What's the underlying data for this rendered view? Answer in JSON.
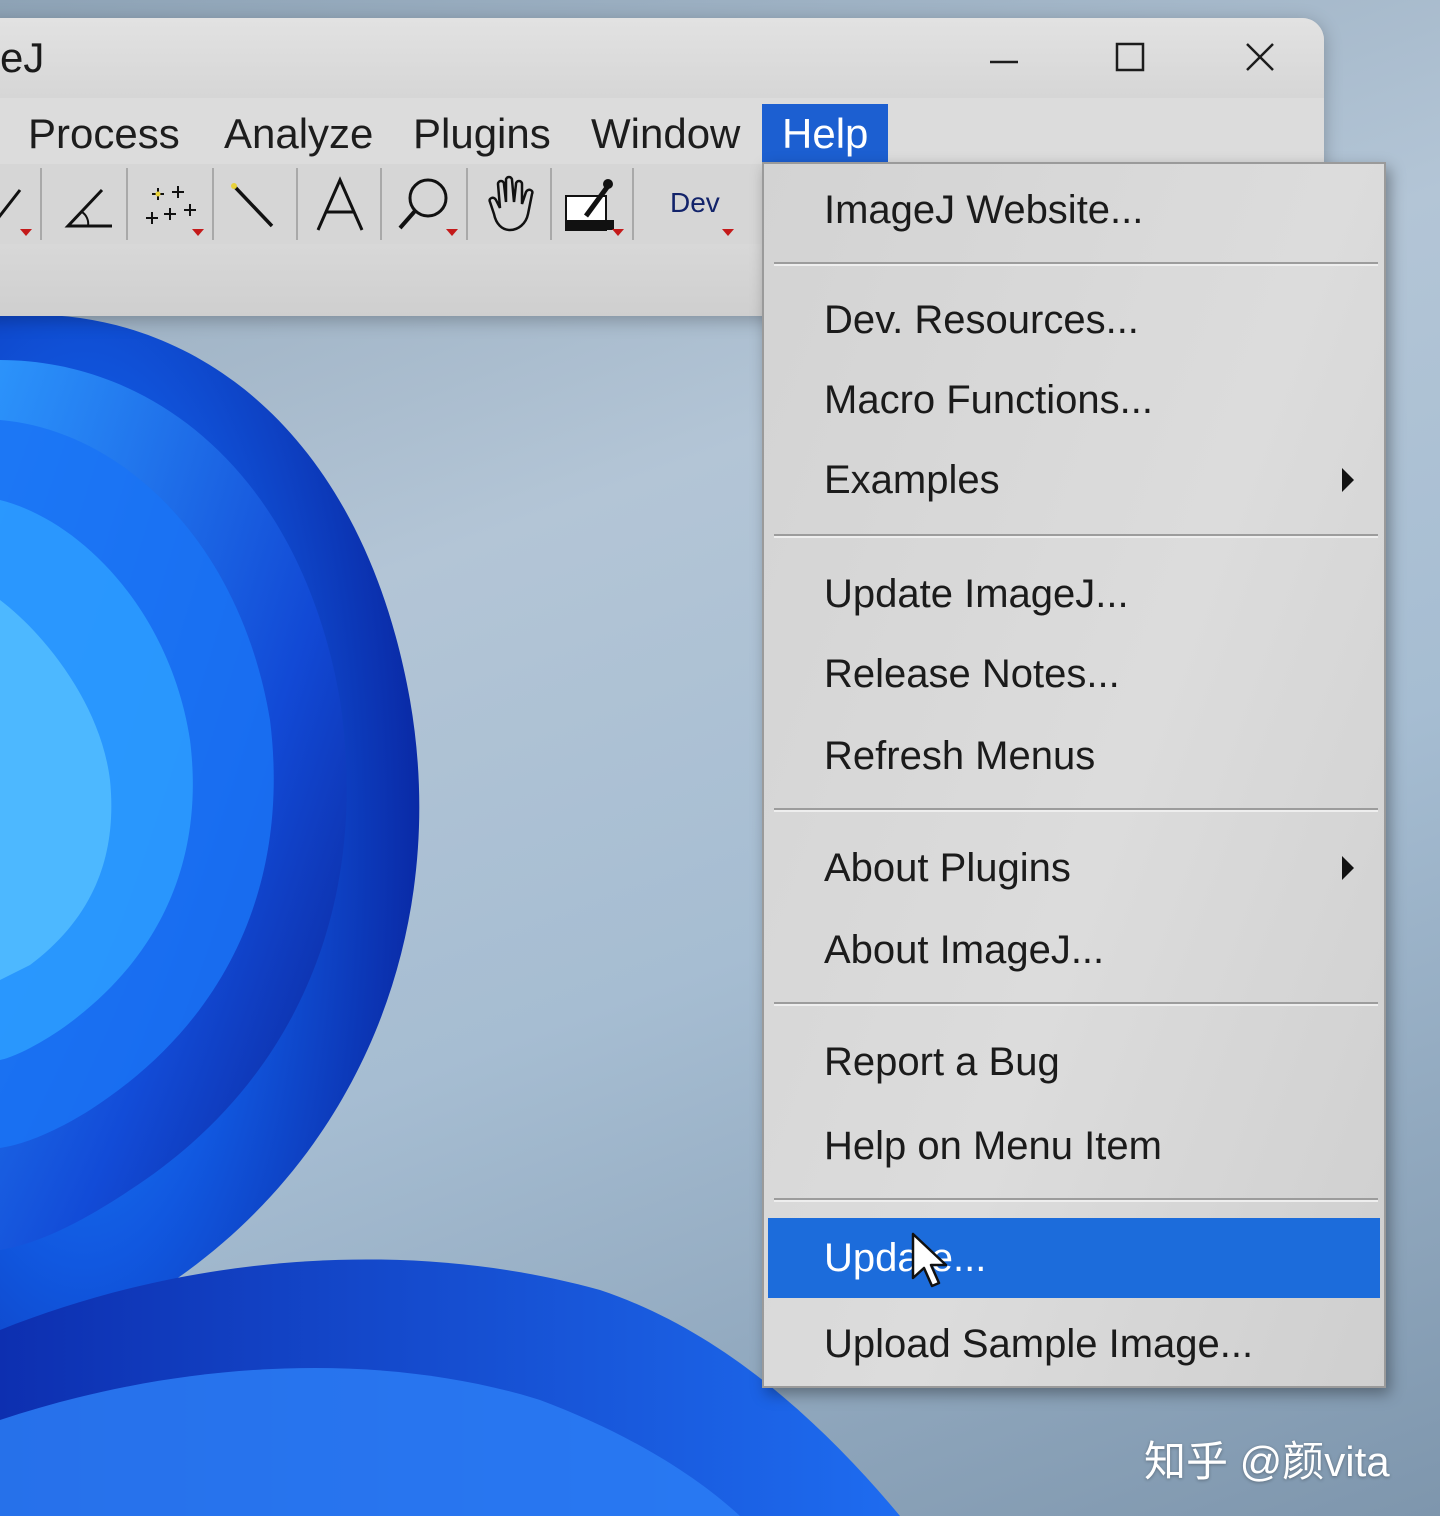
{
  "window": {
    "title": "eJ"
  },
  "menubar": {
    "items": [
      {
        "label": "Process"
      },
      {
        "label": "Analyze"
      },
      {
        "label": "Plugins"
      },
      {
        "label": "Window"
      },
      {
        "label": "Help",
        "active": true
      }
    ]
  },
  "toolbar": {
    "tools": [
      {
        "icon": "line-tool-icon"
      },
      {
        "icon": "angle-tool-icon"
      },
      {
        "icon": "point-tool-icon"
      },
      {
        "icon": "wand-tool-icon"
      },
      {
        "icon": "text-tool-icon"
      },
      {
        "icon": "magnifier-tool-icon"
      },
      {
        "icon": "hand-tool-icon"
      },
      {
        "icon": "color-picker-tool-icon"
      },
      {
        "icon": "dev-tool-icon",
        "label": "Dev"
      }
    ]
  },
  "help_menu": {
    "items": [
      {
        "label": "ImageJ Website..."
      },
      {
        "label": "Dev. Resources..."
      },
      {
        "label": "Macro Functions..."
      },
      {
        "label": "Examples",
        "submenu": true
      },
      {
        "label": "Update ImageJ..."
      },
      {
        "label": "Release Notes..."
      },
      {
        "label": "Refresh Menus"
      },
      {
        "label": "About Plugins",
        "submenu": true
      },
      {
        "label": "About ImageJ..."
      },
      {
        "label": "Report a Bug"
      },
      {
        "label": "Help on Menu Item"
      },
      {
        "label": "Update...",
        "highlighted": true
      },
      {
        "label": "Upload Sample Image..."
      }
    ]
  },
  "watermark": "知乎 @颜vita",
  "colors": {
    "menu_highlight": "#1c6cdb",
    "menubar_active": "#1c5fd1",
    "window_bg": "#d9d9d9"
  }
}
